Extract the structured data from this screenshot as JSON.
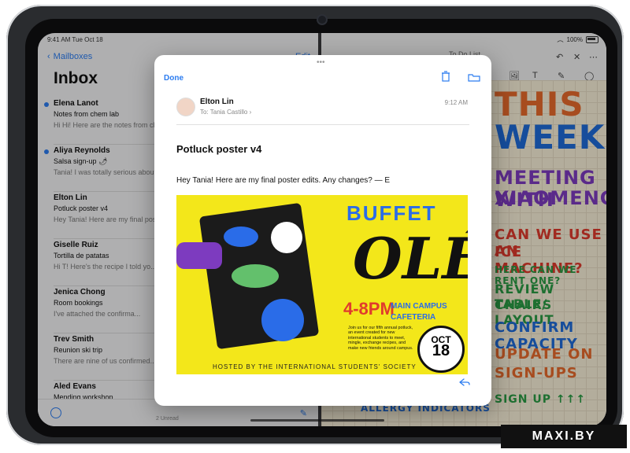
{
  "status": {
    "time": "9:41 AM  Tue Oct 18",
    "battery": "100%"
  },
  "mail": {
    "back_label": "Mailboxes",
    "edit_label": "Edit",
    "title": "Inbox",
    "items": [
      {
        "from": "Elena Lanot",
        "subject": "Notes from chem lab",
        "preview": "Hi Hi! Here are the notes from class and the delay. Let me know if anything...",
        "unread": true
      },
      {
        "from": "Aliya Reynolds",
        "subject": "Salsa sign-up 🌶",
        "preview": "Tania! I was totally serious about...",
        "unread": true
      },
      {
        "from": "Elton Lin",
        "subject": "Potluck poster v4",
        "preview": "Hey Tania! Here are my final poste...",
        "unread": false
      },
      {
        "from": "Giselle Ruiz",
        "subject": "Tortilla de patatas",
        "preview": "Hi T! Here's the recipe I told yo...",
        "unread": false
      },
      {
        "from": "Jenica Chong",
        "subject": "Room bookings",
        "preview": "I've attached the confirma...",
        "unread": false
      },
      {
        "from": "Trev Smith",
        "subject": "Reunion ski trip",
        "preview": "There are nine of us confirmed...",
        "unread": false
      },
      {
        "from": "Aled Evans",
        "subject": "Mending workshop",
        "preview": "",
        "unread": false
      }
    ],
    "footer_status": "2 Unread"
  },
  "notes": {
    "title": "To Do List",
    "lines": [
      "THIS",
      "WEEK",
      "MEETING WITH",
      "XIAOMENG",
      "CAN WE USE AN",
      "ICE MACHINE?",
      "HERE CAN WE RENT ONE?",
      "REVIEW TABLE/",
      "CHAIRS LAYOUT",
      "CONFIRM CAPACITY",
      "UPDATE ON",
      "SIGN-UPS",
      "SIGN UP ↑↑↑",
      "ALLERGY INDICATORS"
    ]
  },
  "message": {
    "done_label": "Done",
    "sender": "Elton Lin",
    "to_label": "To:",
    "recipient": "Tania Castillo",
    "time": "9:12 AM",
    "subject": "Potluck poster v4",
    "body": "Hey Tania! Here are my final poster edits. Any changes? — E"
  },
  "poster": {
    "title_1": "BUFFET",
    "title_2": "OLÉ",
    "time": "4-8PM",
    "place_1": "MAIN CAMPUS",
    "place_2": "CAFETERIA",
    "blurb": "Join us for our fifth annual potluck, an event created for new international students to meet, mingle, exchange recipes, and make new friends around campus.",
    "date_month": "OCT",
    "date_day": "18",
    "hosted": "HOSTED BY THE INTERNATIONAL STUDENTS' SOCIETY"
  },
  "watermark": "MAXI.BY"
}
